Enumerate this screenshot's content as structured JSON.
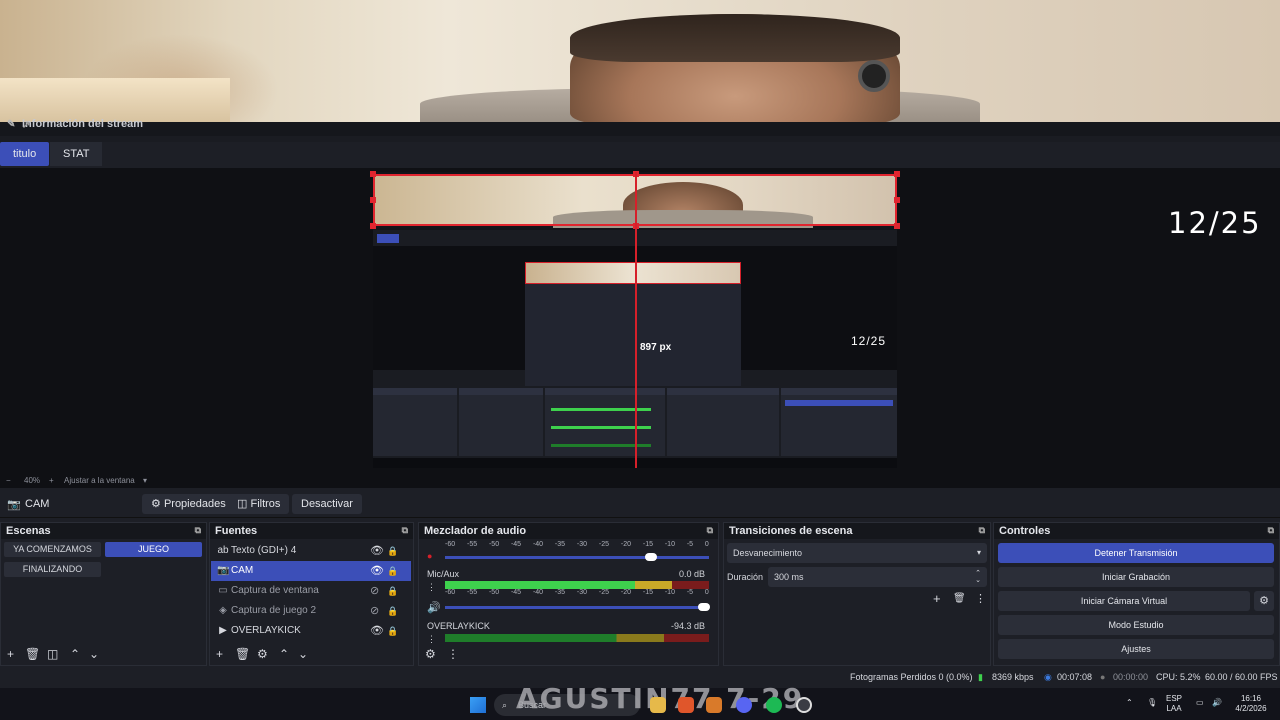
{
  "stream_info": {
    "title": "Información del stream"
  },
  "tabs": [
    {
      "label": "titulo"
    },
    {
      "label": "STAT"
    }
  ],
  "preview": {
    "overlay_text": "12/25",
    "mini_overlay_text": "12/25",
    "guide_label": "897 px",
    "zoom_minus": "−",
    "zoom_value": "40%",
    "zoom_plus": "+",
    "zoom_fit": "Ajustar a la ventana"
  },
  "source_toolbar": {
    "source_name": "CAM",
    "properties_label": "Propiedades",
    "filters_label": "Filtros",
    "deactivate_label": "Desactivar"
  },
  "scenes": {
    "title": "Escenas",
    "items": [
      {
        "label": "YA COMENZAMOS"
      },
      {
        "label": "JUEGO"
      },
      {
        "label": "FINALIZANDO"
      }
    ]
  },
  "sources": {
    "title": "Fuentes",
    "items": [
      {
        "label": "Texto (GDI+) 4",
        "icon": "text-icon"
      },
      {
        "label": "CAM",
        "icon": "camera-icon"
      },
      {
        "label": "Captura de ventana",
        "icon": "window-icon"
      },
      {
        "label": "Captura de juego 2",
        "icon": "gamepad-icon"
      },
      {
        "label": "OVERLAYKICK",
        "icon": "play-icon"
      }
    ]
  },
  "mixer": {
    "title": "Mezclador de audio",
    "scale": [
      "-60",
      "-55",
      "-50",
      "-45",
      "-40",
      "-35",
      "-30",
      "-25",
      "-20",
      "-15",
      "-10",
      "-5",
      "0"
    ],
    "channels": [
      {
        "name": "Mic/Aux",
        "db": "0.0 dB",
        "volume": 0.98
      },
      {
        "name": "OVERLAYKICK",
        "db": "-94.3 dB"
      }
    ],
    "first_volume": 0.78
  },
  "transitions": {
    "title": "Transiciones de escena",
    "selected": "Desvanecimiento",
    "duration_label": "Duración",
    "duration_value": "300 ms"
  },
  "controls": {
    "title": "Controles",
    "stop_stream": "Detener Transmisión",
    "start_recording": "Iniciar Grabación",
    "start_virtual_cam": "Iniciar Cámara Virtual",
    "studio_mode": "Modo Estudio",
    "settings": "Ajustes"
  },
  "status": {
    "dropped_frames": "Fotogramas Perdidos 0 (0.0%)",
    "bitrate": "8369 kbps",
    "stream_time": "00:07:08",
    "rec_time": "00:00:00",
    "cpu": "CPU: 5.2%",
    "fps": "60.00 / 60.00 FPS"
  },
  "taskbar": {
    "search_placeholder": "Buscar",
    "watermark": "AGUSTIN77.7-29",
    "language_top": "ESP",
    "language_bottom": "LAA",
    "time": "16:16",
    "date": "4/2/2026"
  },
  "colors": {
    "accent": "#3c4fb8",
    "selection_red": "#e0252f",
    "meter_green": "#3ed14d",
    "meter_yellow": "#c9a928",
    "meter_red": "#7a1c1c"
  }
}
